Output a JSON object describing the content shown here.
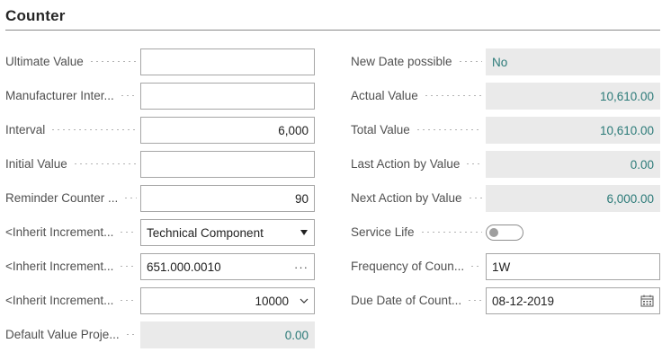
{
  "section": {
    "title": "Counter"
  },
  "left": [
    {
      "label": "Ultimate Value",
      "value": ""
    },
    {
      "label": "Manufacturer Inter...",
      "value": ""
    },
    {
      "label": "Interval",
      "value": "6,000"
    },
    {
      "label": "Initial Value",
      "value": ""
    },
    {
      "label": "Reminder Counter ...",
      "value": "90"
    },
    {
      "label": "<Inherit Increment...",
      "value": "Technical Component",
      "icon": "caret-down-icon"
    },
    {
      "label": "<Inherit Increment...",
      "value": "651.000.0010",
      "icon": "ellipsis-icon"
    },
    {
      "label": "<Inherit Increment...",
      "value": "10000",
      "icon": "chevron-down-icon"
    },
    {
      "label": "Default Value Proje...",
      "value": "0.00"
    }
  ],
  "right": [
    {
      "label": "New Date possible",
      "value": "No"
    },
    {
      "label": "Actual Value",
      "value": "10,610.00"
    },
    {
      "label": "Total Value",
      "value": "10,610.00"
    },
    {
      "label": "Last Action by Value",
      "value": "0.00"
    },
    {
      "label": "Next Action by Value",
      "value": "6,000.00"
    },
    {
      "label": "Service Life",
      "toggle_on": false
    },
    {
      "label": "Frequency of Coun...",
      "value": "1W"
    },
    {
      "label": "Due Date of Count...",
      "value": "08-12-2019",
      "icon": "calendar-icon"
    }
  ],
  "colors": {
    "readonly_bg": "#eaeaea",
    "readonly_text": "#2b7a78",
    "border": "#a6a6a6"
  }
}
